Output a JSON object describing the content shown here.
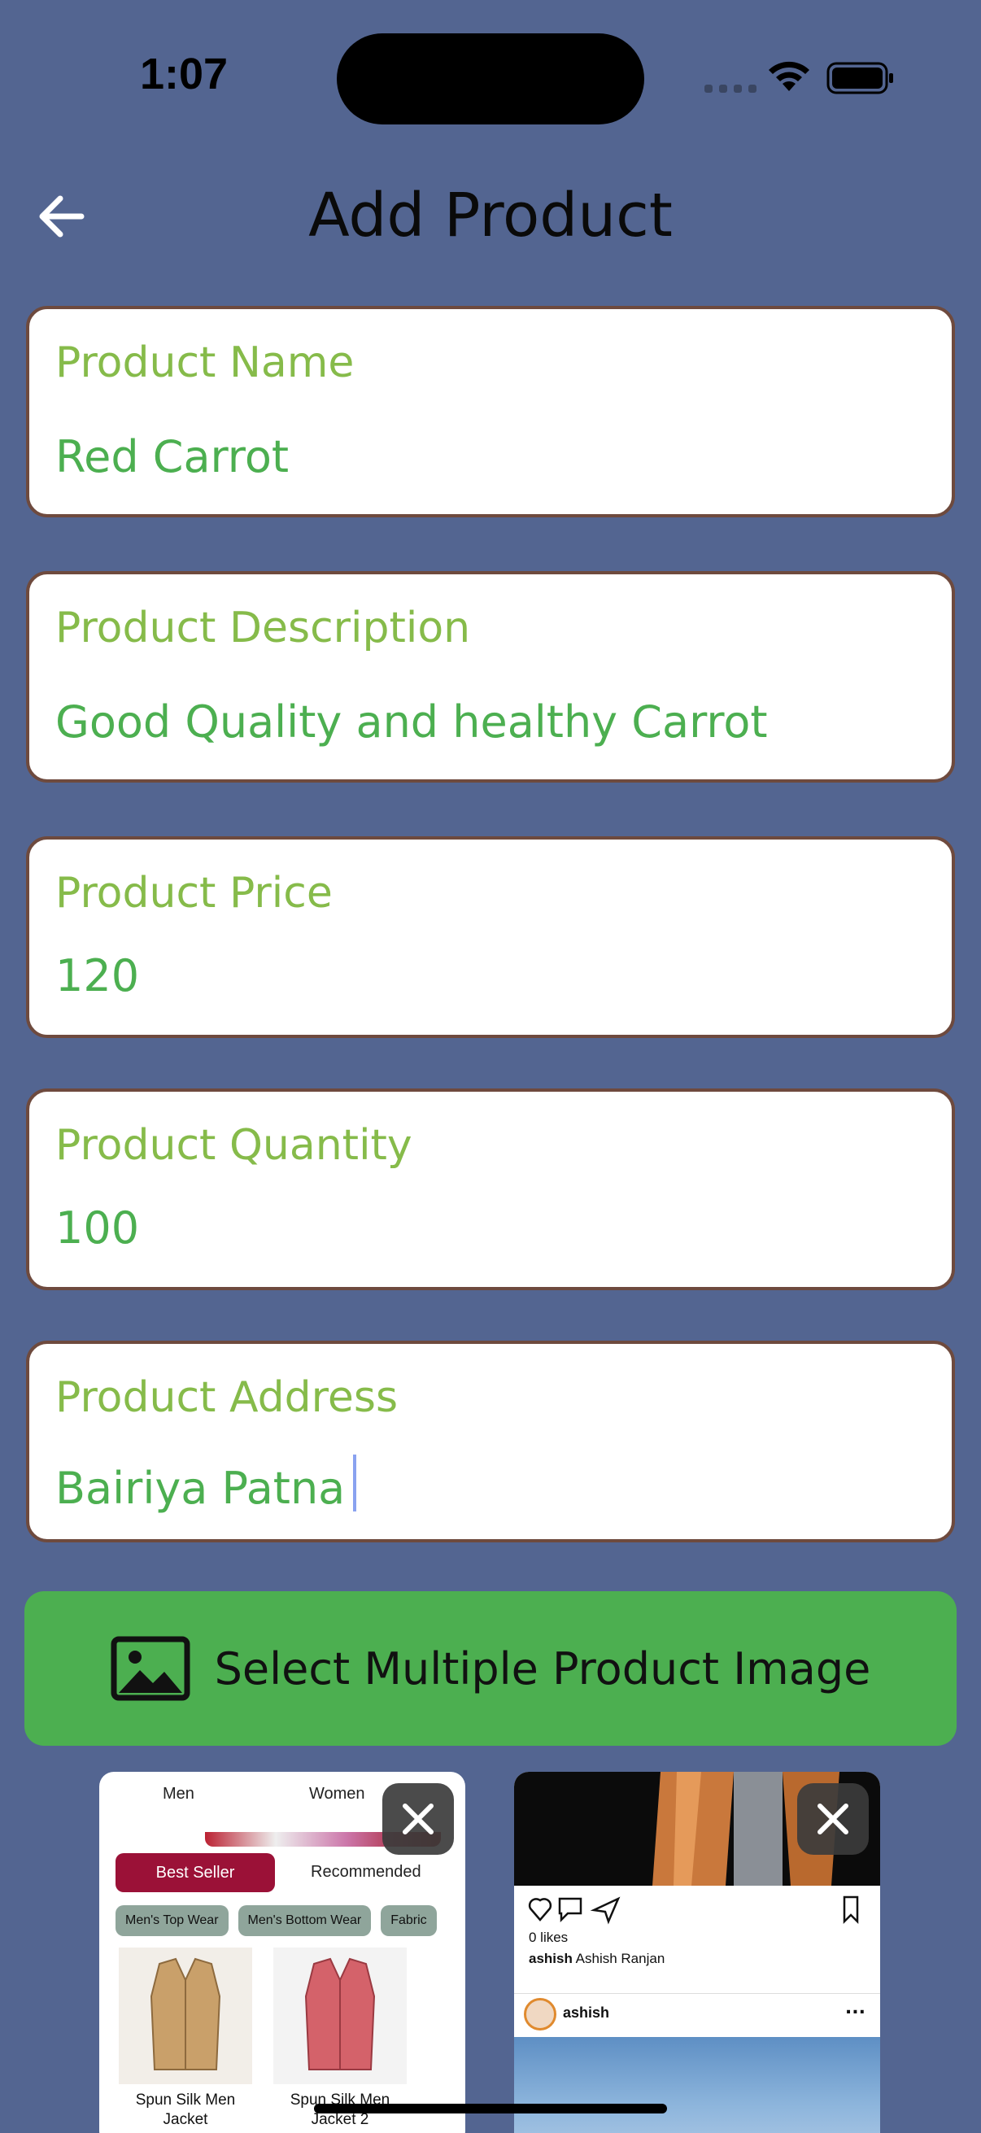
{
  "status_bar": {
    "time": "1:07"
  },
  "header": {
    "title": "Add Product"
  },
  "form": {
    "name": {
      "label": "Product Name",
      "value": "Red Carrot"
    },
    "description": {
      "label": "Product Description",
      "value": "Good Quality and healthy Carrot"
    },
    "price": {
      "label": "Product Price",
      "value": "120"
    },
    "quantity": {
      "label": "Product Quantity",
      "value": "100"
    },
    "address": {
      "label": "Product Address",
      "value": "Bairiya Patna"
    }
  },
  "select_button": {
    "label": "Select Multiple Product Image",
    "icon": "image-icon"
  },
  "thumbnails": {
    "shop": {
      "tab_men": "Men",
      "tab_women": "Women",
      "best_seller": "Best Seller",
      "recommended": "Recommended",
      "chips": [
        "Men's Top Wear",
        "Men's Bottom Wear",
        "Fabric"
      ],
      "products": [
        "Spun Silk Men Jacket",
        "Spun Silk Men Jacket 2"
      ]
    },
    "post": {
      "likes": "0 likes",
      "caption_user": "ashish",
      "caption_text": "Ashish Ranjan",
      "username": "ashish",
      "more": "..."
    }
  },
  "colors": {
    "background": "#536591",
    "label_green": "#86bb4a",
    "value_green": "#4caf50",
    "button_green": "#4caf50",
    "field_border": "#6e4a3e"
  }
}
